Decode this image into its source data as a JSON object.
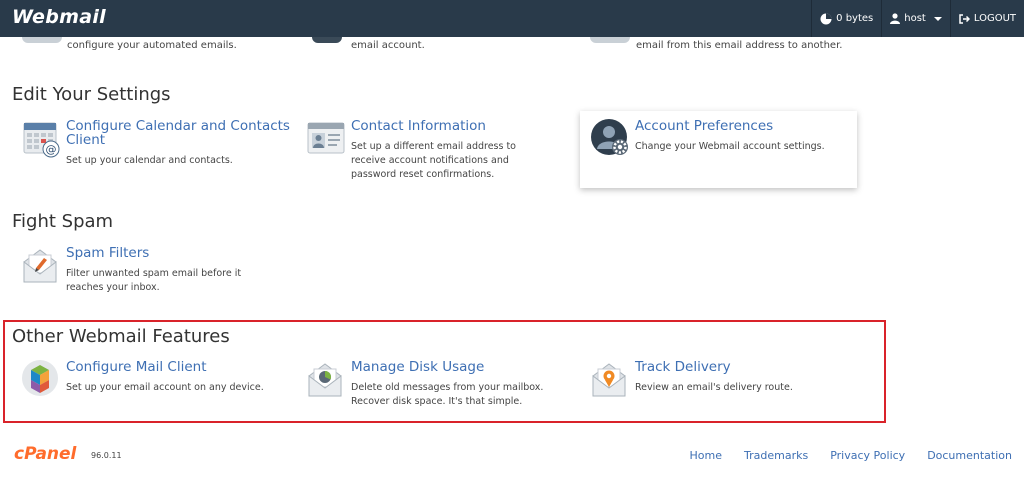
{
  "header": {
    "logo": "Webmail",
    "disk_usage": "0 bytes",
    "user": "host",
    "logout": "LOGOUT"
  },
  "partial_section": {
    "items": [
      {
        "description": "configure your automated emails."
      },
      {
        "description": "email account."
      },
      {
        "description": "email from this email address to another."
      }
    ]
  },
  "sections": {
    "settings": {
      "title": "Edit Your Settings",
      "items": [
        {
          "title": "Configure Calendar and Contacts Client",
          "description": "Set up your calendar and contacts.",
          "icon": "calendar-contacts-icon"
        },
        {
          "title": "Contact Information",
          "description": "Set up a different email address to receive account notifications and password reset confirmations.",
          "icon": "contact-card-icon"
        },
        {
          "title": "Account Preferences",
          "description": "Change your Webmail account settings.",
          "icon": "user-gear-icon"
        }
      ]
    },
    "spam": {
      "title": "Fight Spam",
      "items": [
        {
          "title": "Spam Filters",
          "description": "Filter unwanted spam email before it reaches your inbox.",
          "icon": "envelope-pen-icon"
        }
      ]
    },
    "other": {
      "title": "Other Webmail Features",
      "items": [
        {
          "title": "Configure Mail Client",
          "description": "Set up your email account on any device.",
          "icon": "mail-client-cube-icon"
        },
        {
          "title": "Manage Disk Usage",
          "description": "Delete old messages from your mailbox. Recover disk space. It's that simple.",
          "icon": "envelope-pie-icon"
        },
        {
          "title": "Track Delivery",
          "description": "Review an email's delivery route.",
          "icon": "envelope-pin-icon"
        }
      ]
    }
  },
  "footer": {
    "logo": "cPanel",
    "version": "96.0.11",
    "links": [
      "Home",
      "Trademarks",
      "Privacy Policy",
      "Documentation"
    ]
  },
  "colors": {
    "topbar": "#293a4a",
    "link": "#3e6fb3",
    "highlight": "#d9232a",
    "cpanel_orange": "#ff6c2c"
  }
}
